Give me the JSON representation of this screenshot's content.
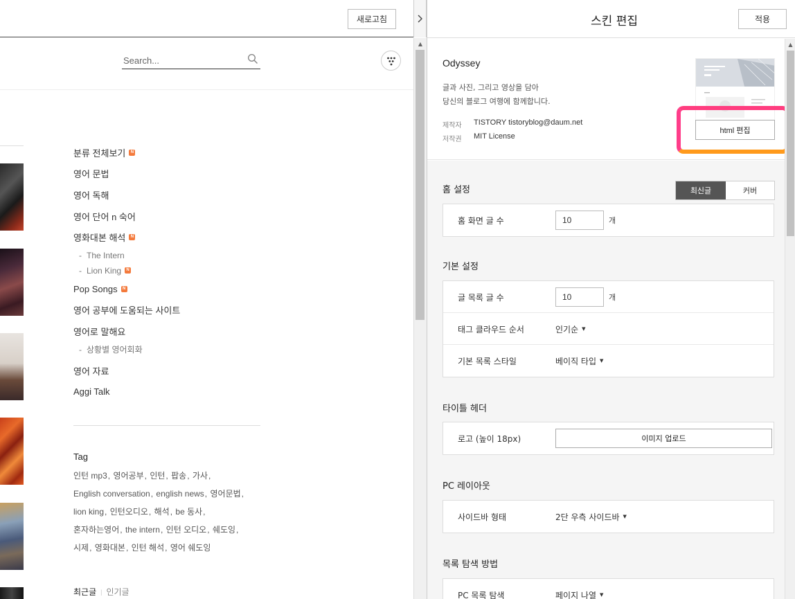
{
  "preview": {
    "refresh_label": "새로고침",
    "collapse_icon": "chevron-right-icon",
    "search": {
      "placeholder": "Search..."
    },
    "categories": [
      {
        "label": "분류 전체보기",
        "new": true
      },
      {
        "label": "영어 문법",
        "new": false
      },
      {
        "label": "영어 독해",
        "new": false
      },
      {
        "label": "영어 단어 n 숙어",
        "new": false
      },
      {
        "label": "영화대본 해석",
        "new": true
      }
    ],
    "subcategories_1": [
      {
        "label": "The Intern",
        "new": false
      },
      {
        "label": "Lion King",
        "new": true
      }
    ],
    "categories_2": [
      {
        "label": "Pop Songs",
        "new": true
      },
      {
        "label": "영어 공부에 도움되는 사이트",
        "new": false
      },
      {
        "label": "영어로 말해요",
        "new": false
      }
    ],
    "subcategories_2": [
      {
        "label": "상황별 영어회화",
        "new": false
      }
    ],
    "categories_3": [
      {
        "label": "영어 자료",
        "new": false
      },
      {
        "label": "Aggi Talk",
        "new": false
      }
    ],
    "dash": "-",
    "tag_title": "Tag",
    "tags": [
      "인턴 mp3",
      "영어공부",
      "인턴",
      "팝송",
      "가사",
      "English conversation",
      "english news",
      "영어문법",
      "lion king",
      "인턴오디오",
      "해석",
      "be 동사",
      "혼자하는영어",
      "the intern",
      "인턴 오디오",
      "쉐도잉",
      "시제",
      "영화대본",
      "인턴 해석",
      "영어 쉐도잉"
    ],
    "recent_tab": "최근글",
    "popular_tab": "인기글",
    "new_badge": "N"
  },
  "skin_editor": {
    "title": "스킨 편집",
    "apply_label": "적용",
    "skin_name": "Odyssey",
    "desc_line1": "글과 사진, 그리고 영상을 담아",
    "desc_line2": "당신의 블로그 여행에 함께합니다.",
    "author_label": "제작자",
    "author_value": "TISTORY tistoryblog@daum.net",
    "license_label": "저작권",
    "license_value": "MIT License",
    "html_edit_label": "html 편집",
    "home": {
      "title": "홈 설정",
      "tab_recent": "최신글",
      "tab_cover": "커버",
      "post_count_label": "홈 화면 글 수",
      "post_count_value": "10",
      "unit": "개"
    },
    "basic": {
      "title": "기본 설정",
      "list_count_label": "글 목록 글 수",
      "list_count_value": "10",
      "unit": "개",
      "tag_order_label": "태그 클라우드 순서",
      "tag_order_value": "인기순",
      "list_style_label": "기본 목록 스타일",
      "list_style_value": "베이직 타입"
    },
    "title_header": {
      "title": "타이틀 헤더",
      "logo_label": "로고 (높이 18px)",
      "upload_label": "이미지 업로드"
    },
    "pc_layout": {
      "title": "PC 레이아웃",
      "sidebar_label": "사이드바 형태",
      "sidebar_value": "2단 우측 사이드바"
    },
    "list_nav": {
      "title": "목록 탐색 방법",
      "pc_label": "PC 목록 탐색",
      "pc_value": "페이지 나열"
    }
  },
  "colors": {
    "highlight_pink": "#ff3d7f",
    "highlight_orange": "#ff9a1c",
    "new_badge": "#f47a3c",
    "active_tab": "#555555"
  }
}
